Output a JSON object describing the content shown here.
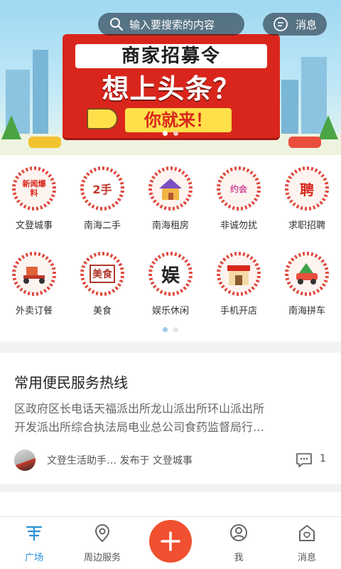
{
  "banner": {
    "poster_top": "商家招募令",
    "poster_main": "想上头条？",
    "poster_sub": "你就来！",
    "search_placeholder": "输入要搜索的内容",
    "messages_label": "消息"
  },
  "categories": [
    {
      "label": "文登城事",
      "icon": "news-icon",
      "glyph": "新闻爆料"
    },
    {
      "label": "南海二手",
      "icon": "second-hand-icon",
      "glyph": "2手"
    },
    {
      "label": "南海租房",
      "icon": "house-rent-icon",
      "glyph": ""
    },
    {
      "label": "非诚勿扰",
      "icon": "dating-icon",
      "glyph": "约会"
    },
    {
      "label": "求职招聘",
      "icon": "recruit-icon",
      "glyph": "聘"
    },
    {
      "label": "外卖订餐",
      "icon": "delivery-icon",
      "glyph": ""
    },
    {
      "label": "美食",
      "icon": "food-icon",
      "glyph": "美食"
    },
    {
      "label": "娱乐休闲",
      "icon": "entertainment-icon",
      "glyph": "娱"
    },
    {
      "label": "手机开店",
      "icon": "shop-icon",
      "glyph": ""
    },
    {
      "label": "南海拼车",
      "icon": "carpool-icon",
      "glyph": ""
    }
  ],
  "post": {
    "title": "常用便民服务热线",
    "line1": "区政府区长电话天福派出所龙山派出所环山派出所",
    "line2": "开发派出所综合执法局电业总公司食药监督局行…",
    "author": "文登生活助手…  发布于 文登城事",
    "comments": "1"
  },
  "next_post_peek": "",
  "tabbar": {
    "items": [
      {
        "label": "广场",
        "icon": "square-icon",
        "active": true
      },
      {
        "label": "周边服务",
        "icon": "location-icon",
        "active": false
      },
      {
        "label": "",
        "icon": "plus-icon",
        "active": false
      },
      {
        "label": "我",
        "icon": "user-icon",
        "active": false
      },
      {
        "label": "消息",
        "icon": "message-icon",
        "active": false
      }
    ]
  },
  "colors": {
    "accent_red": "#d9261c",
    "tab_active": "#2b8fd6",
    "fab": "#f0502f"
  }
}
